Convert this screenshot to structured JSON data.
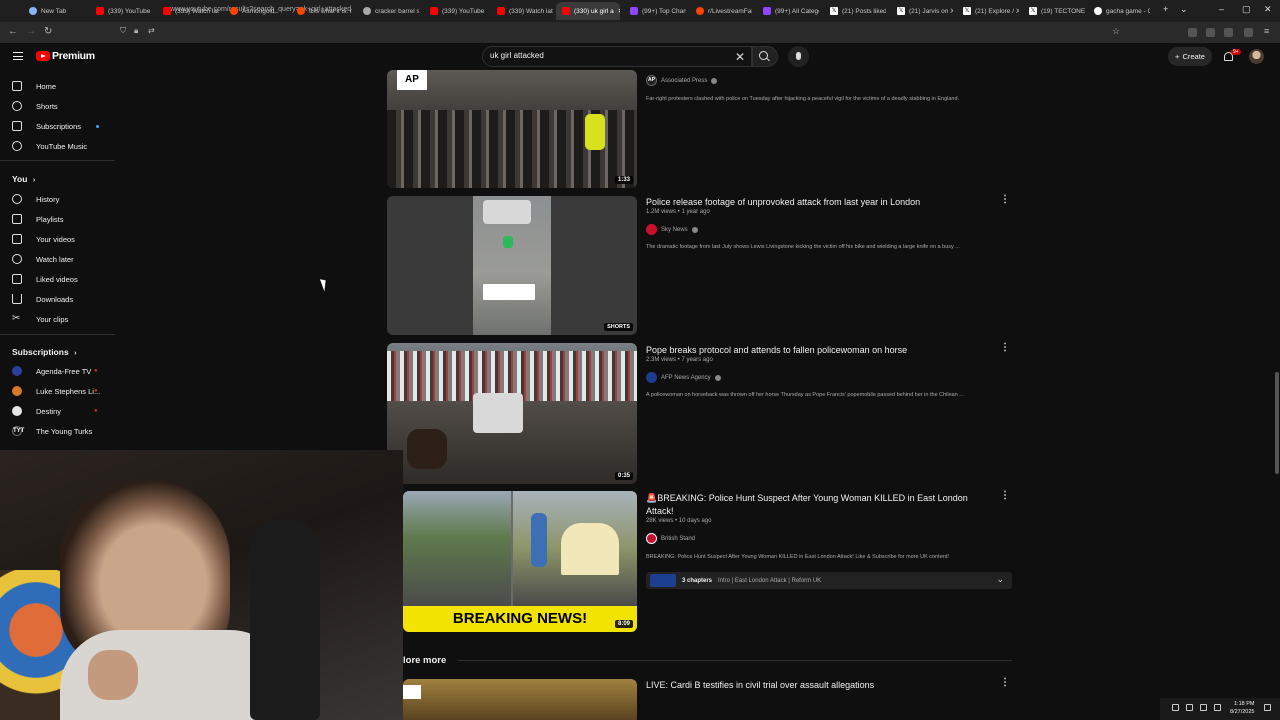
{
  "browser": {
    "tabs": [
      {
        "label": "New Tab",
        "icon": "new-tab-icon"
      },
      {
        "label": "(339) YouTube",
        "icon": "youtube-icon"
      },
      {
        "label": "(339) Watch late",
        "icon": "youtube-icon"
      },
      {
        "label": "Asmongold",
        "icon": "reddit-icon"
      },
      {
        "label": "It is what it is. r",
        "icon": "reddit-icon"
      },
      {
        "label": "cracker barrel st",
        "icon": "site-icon"
      },
      {
        "label": "(339) YouTube",
        "icon": "youtube-icon"
      },
      {
        "label": "(339) Watch late",
        "icon": "youtube-icon"
      },
      {
        "label": "(330) uk girl a",
        "icon": "youtube-icon"
      },
      {
        "label": "(99+) Top Chann",
        "icon": "twitch-icon"
      },
      {
        "label": "r/LivestreamFail",
        "icon": "reddit-icon"
      },
      {
        "label": "(99+) All Catego",
        "icon": "twitch-icon"
      },
      {
        "label": "(21) Posts liked b",
        "icon": "x-icon"
      },
      {
        "label": "(21) Jarvis on X:",
        "icon": "x-icon"
      },
      {
        "label": "(21) Explore / X",
        "icon": "x-icon"
      },
      {
        "label": "(19) TECTONE",
        "icon": "x-icon"
      },
      {
        "label": "gacha game - G",
        "icon": "google-icon"
      }
    ],
    "active_tab_index": 8,
    "url": "www.youtube.com/results?search_query=uk+girl+attacked"
  },
  "header": {
    "logo_text": "Premium",
    "search_value": "uk girl attacked",
    "create_label": "Create",
    "notification_badge": "9+"
  },
  "sidebar": {
    "main": [
      {
        "label": "Home",
        "icon": "home-icon"
      },
      {
        "label": "Shorts",
        "icon": "shorts-icon"
      },
      {
        "label": "Subscriptions",
        "icon": "subscriptions-icon"
      },
      {
        "label": "YouTube Music",
        "icon": "music-icon"
      }
    ],
    "you_heading": "You",
    "you": [
      {
        "label": "History",
        "icon": "history-icon"
      },
      {
        "label": "Playlists",
        "icon": "playlists-icon"
      },
      {
        "label": "Your videos",
        "icon": "your-videos-icon"
      },
      {
        "label": "Watch later",
        "icon": "watch-later-icon"
      },
      {
        "label": "Liked videos",
        "icon": "liked-icon"
      },
      {
        "label": "Downloads",
        "icon": "downloads-icon"
      },
      {
        "label": "Your clips",
        "icon": "clips-icon"
      }
    ],
    "subs_heading": "Subscriptions",
    "subs": [
      {
        "label": "Agenda-Free TV",
        "color": "#2a3f9a"
      },
      {
        "label": "Luke Stephens Li...",
        "color": "#d9782c"
      },
      {
        "label": "Destiny",
        "color": "#e6e6e6"
      },
      {
        "label": "The Young Turks",
        "color": "#111111"
      }
    ]
  },
  "results": [
    {
      "channel": "Associated Press",
      "desc": "Far-right protesters clashed with police on Tuesday after hijacking a peaceful vigil for the victims of a deadly stabbing in England.",
      "duration": "1:33",
      "chan_color": "#222222"
    },
    {
      "title": "Police release footage of unprovoked attack from last year in London",
      "meta": "1.2M views • 1 year ago",
      "channel": "Sky News",
      "desc": "The dramatic footage from last July shows Lewis Livingstone kicking the victim off his bike and wielding a large knife on a busy ...",
      "badge": "SHORTS",
      "chan_color": "#c8102e"
    },
    {
      "title": "Pope breaks protocol and attends to fallen policewoman on horse",
      "meta": "2.3M views • 7 years ago",
      "channel": "AFP News Agency",
      "desc": "A policewoman on horseback was thrown off her horse Thursday as Pope Francis' popemobile passed behind her in the Chilean ...",
      "duration": "0:35",
      "chan_color": "#1d3c8f"
    },
    {
      "title": "🚨BREAKING: Police Hunt Suspect After Young Woman KILLED in East London Attack!",
      "meta": "28K views • 10 days ago",
      "channel": "British Stand",
      "desc": "BREAKING: Police Hunt Suspect After Young Woman KILLED in East London Attack! Like & Subscribe for more UK content!",
      "duration": "8:09",
      "thumb_text": "BREAKING NEWS!",
      "chan_color": "#c8102e",
      "chapters_count": "3 chapters",
      "chapters_list": "Intro | East London Attack | Reform UK"
    },
    {
      "title": "LIVE: Cardi B testifies in civil trial over assault allegations"
    }
  ],
  "more_label": "lore more",
  "clock": {
    "time": "1:18 PM",
    "date": "8/27/2025"
  }
}
